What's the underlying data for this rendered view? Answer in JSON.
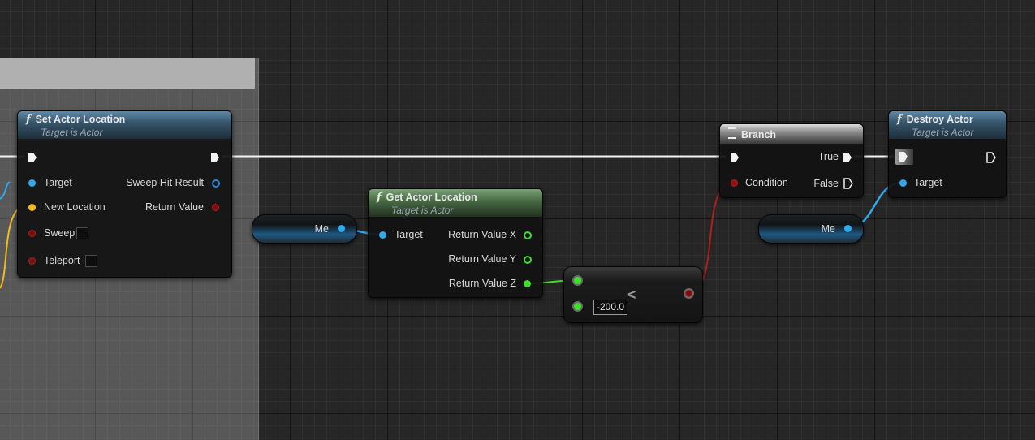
{
  "nodes": {
    "set_actor_location": {
      "title": "Set Actor Location",
      "subtitle": "Target is Actor",
      "pins": {
        "target": "Target",
        "new_location": "New Location",
        "sweep": "Sweep",
        "teleport": "Teleport",
        "sweep_hit_result": "Sweep Hit Result",
        "return_value": "Return Value"
      }
    },
    "get_actor_location": {
      "title": "Get Actor Location",
      "subtitle": "Target is Actor",
      "pins": {
        "target": "Target",
        "return_x": "Return Value X",
        "return_y": "Return Value Y",
        "return_z": "Return Value Z"
      }
    },
    "self_ref_1": {
      "label": "Me"
    },
    "self_ref_2": {
      "label": "Me"
    },
    "compare": {
      "operator": "<",
      "value": "-200.0"
    },
    "branch": {
      "title": "Branch",
      "pins": {
        "condition": "Condition",
        "true": "True",
        "false": "False"
      }
    },
    "destroy_actor": {
      "title": "Destroy Actor",
      "subtitle": "Target is Actor",
      "pins": {
        "target": "Target"
      }
    }
  },
  "colors": {
    "exec_wire": "#ffffff",
    "object_pin": "#2fa8ec",
    "vector_pin": "#f0bc1c",
    "bool_pin": "#b01e1e",
    "float_pin": "#3ee02a"
  }
}
